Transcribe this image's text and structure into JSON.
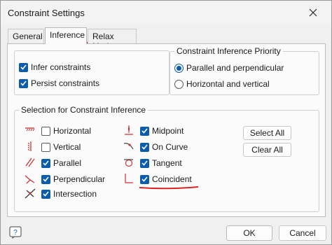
{
  "window": {
    "title": "Constraint Settings"
  },
  "tabs": [
    {
      "label": "General"
    },
    {
      "label": "Inference"
    },
    {
      "label": "Relax Mode"
    }
  ],
  "left_options": [
    {
      "label": "Infer constraints",
      "checked": true
    },
    {
      "label": "Persist constraints",
      "checked": true
    }
  ],
  "priority": {
    "title": "Constraint Inference Priority",
    "options": [
      {
        "label": "Parallel and perpendicular",
        "selected": true
      },
      {
        "label": "Horizontal and vertical",
        "selected": false
      }
    ]
  },
  "selection": {
    "title": "Selection for Constraint Inference",
    "col1": [
      {
        "label": "Horizontal",
        "checked": false,
        "icon": "horizontal-constraint-icon"
      },
      {
        "label": "Vertical",
        "checked": false,
        "icon": "vertical-constraint-icon"
      },
      {
        "label": "Parallel",
        "checked": true,
        "icon": "parallel-constraint-icon"
      },
      {
        "label": "Perpendicular",
        "checked": true,
        "icon": "perpendicular-constraint-icon"
      },
      {
        "label": "Intersection",
        "checked": true,
        "icon": "intersection-constraint-icon"
      }
    ],
    "col2": [
      {
        "label": "Midpoint",
        "checked": true,
        "icon": "midpoint-constraint-icon"
      },
      {
        "label": "On Curve",
        "checked": true,
        "icon": "on-curve-constraint-icon"
      },
      {
        "label": "Tangent",
        "checked": true,
        "icon": "tangent-constraint-icon"
      },
      {
        "label": "Coincident",
        "checked": true,
        "icon": "coincident-constraint-icon"
      }
    ],
    "select_all": "Select All",
    "clear_all": "Clear All"
  },
  "footer": {
    "ok": "OK",
    "cancel": "Cancel",
    "help_icon": "help-icon"
  },
  "colors": {
    "accent": "#0b5cad",
    "annotation": "#dd2222"
  }
}
